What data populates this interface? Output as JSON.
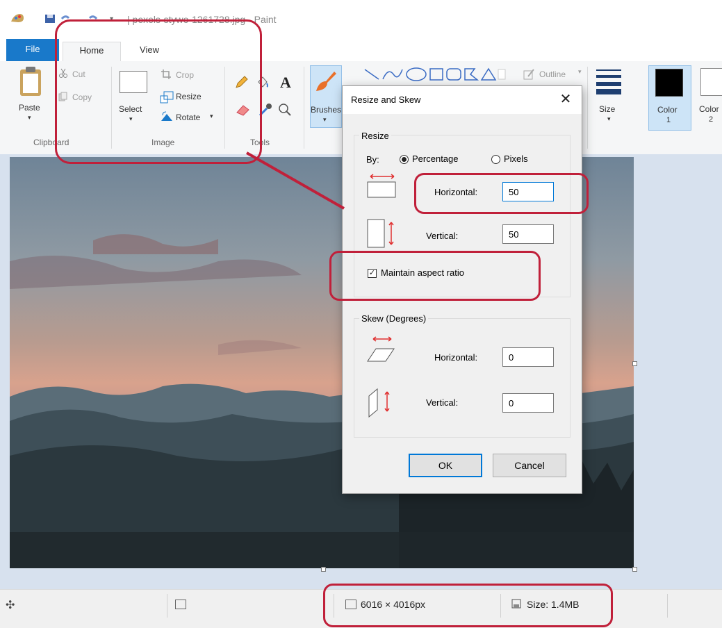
{
  "window": {
    "title": "| pexels-stywo-1261728.jpg - Paint"
  },
  "tabs": [
    {
      "label": "File"
    },
    {
      "label": "Home"
    },
    {
      "label": "View"
    }
  ],
  "ribbon": {
    "clipboard": {
      "paste": "Paste",
      "cut": "Cut",
      "copy": "Copy",
      "group": "Clipboard"
    },
    "image": {
      "select": "Select",
      "crop": "Crop",
      "resize": "Resize",
      "rotate": "Rotate",
      "group": "Image"
    },
    "tools": {
      "group": "Tools"
    },
    "brushes": {
      "label": "Brushes"
    },
    "shapes": {
      "outline": "Outline"
    },
    "size": {
      "label": "Size"
    },
    "color1": {
      "label": "Color",
      "num": "1",
      "value": "#000000"
    },
    "color2": {
      "label": "Color",
      "num": "2",
      "value": "#ffffff"
    }
  },
  "status": {
    "dimensions": "6016 × 4016px",
    "filesize": "Size: 1.4MB"
  },
  "dialog": {
    "title": "Resize and Skew",
    "close": "✕",
    "resize_group": "Resize",
    "by_label": "By:",
    "percentage_label": "Percentage",
    "pixels_label": "Pixels",
    "resize_horizontal_label": "Horizontal:",
    "resize_horizontal_value": "50",
    "resize_vertical_label": "Vertical:",
    "resize_vertical_value": "50",
    "maintain_label": "Maintain aspect ratio",
    "skew_group": "Skew (Degrees)",
    "skew_horizontal_label": "Horizontal:",
    "skew_horizontal_value": "0",
    "skew_vertical_label": "Vertical:",
    "skew_vertical_value": "0",
    "ok": "OK",
    "cancel": "Cancel"
  },
  "colors": {
    "accent": "#1979ca",
    "highlight": "#c0203a"
  }
}
